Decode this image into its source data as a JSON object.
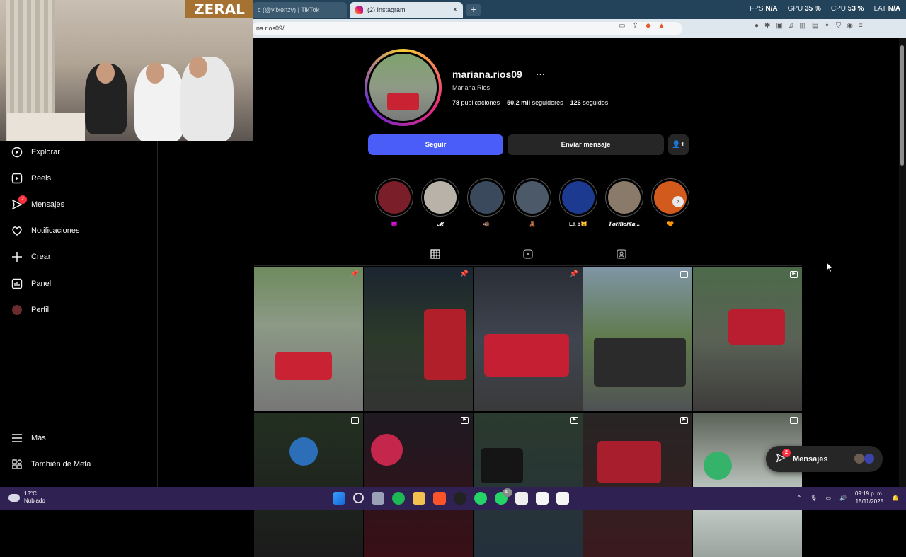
{
  "browser": {
    "tabs": [
      {
        "label": "c (@viixenzy) | TikTok",
        "active": false
      },
      {
        "label": "(2) Instagram",
        "active": true
      }
    ],
    "new_tab": "+",
    "close": "×",
    "url": "na.rios09/",
    "stats": {
      "fps_label": "FPS",
      "fps": "N/A",
      "gpu_label": "GPU",
      "gpu": "35 %",
      "cpu_label": "CPU",
      "cpu": "53 %",
      "lat_label": "LAT",
      "lat": "N/A"
    }
  },
  "overlay": {
    "brand": "ZERAL"
  },
  "sidebar": {
    "items": [
      {
        "label": "Explorar",
        "icon": "compass-icon"
      },
      {
        "label": "Reels",
        "icon": "reels-icon"
      },
      {
        "label": "Mensajes",
        "icon": "messenger-icon",
        "badge": "2"
      },
      {
        "label": "Notificaciones",
        "icon": "heart-icon"
      },
      {
        "label": "Crear",
        "icon": "plus-icon"
      },
      {
        "label": "Panel",
        "icon": "dashboard-icon"
      },
      {
        "label": "Perfil",
        "icon": "avatar-icon"
      }
    ],
    "bottom": [
      {
        "label": "Más",
        "icon": "menu-icon"
      },
      {
        "label": "También de Meta",
        "icon": "meta-icon"
      }
    ]
  },
  "profile": {
    "username": "mariana.rios09",
    "more": "···",
    "full_name": "Mariana Rios",
    "posts_count": "78",
    "posts_label": "publicaciones",
    "followers_count": "50,2 mil",
    "followers_label": "seguidores",
    "following_count": "126",
    "following_label": "seguidos",
    "follow_button": "Seguir",
    "message_button": "Enviar mensaje",
    "add_person_button": "+",
    "accent": "#4a5df9"
  },
  "highlights": [
    {
      "label": "😈",
      "color": "#7a1f2a"
    },
    {
      "label": "𝓜",
      "color": "#b9b2a8"
    },
    {
      "label": "🐗",
      "color": "#3a4a5c"
    },
    {
      "label": "🧸",
      "color": "#4b5968"
    },
    {
      "label": "La 6🐱",
      "color": "#1c3a8f"
    },
    {
      "label": "𝑻𝒐𝒓𝒎𝒆𝒏𝒕𝒂...",
      "color": "#8a7a6a"
    },
    {
      "label": "🧡",
      "color": "#d25a1c"
    }
  ],
  "profile_tabs": [
    "grid-icon",
    "reels-tab-icon",
    "tagged-icon"
  ],
  "posts": [
    {
      "type": "pin",
      "bg": "#6f8a5e"
    },
    {
      "type": "pin",
      "bg": "#1b2430"
    },
    {
      "type": "pin",
      "bg": "#2a2d35"
    },
    {
      "type": "video",
      "bg": "#7f95a6"
    },
    {
      "type": "video",
      "bg": "#4c6a4a"
    },
    {
      "type": "video",
      "bg": "#233021"
    },
    {
      "type": "video",
      "bg": "#1e1a22"
    },
    {
      "type": "video",
      "bg": "#2b3a2e"
    },
    {
      "type": "video",
      "bg": "#272525"
    },
    {
      "type": "video",
      "bg": "#5a6156"
    }
  ],
  "messages_pill": {
    "label": "Mensajes",
    "badge": "2"
  },
  "taskbar": {
    "temp": "13°C",
    "condition": "Nubiado",
    "time": "09:19 p. m.",
    "date": "15/11/2025",
    "whatsapp_badge": "40"
  }
}
